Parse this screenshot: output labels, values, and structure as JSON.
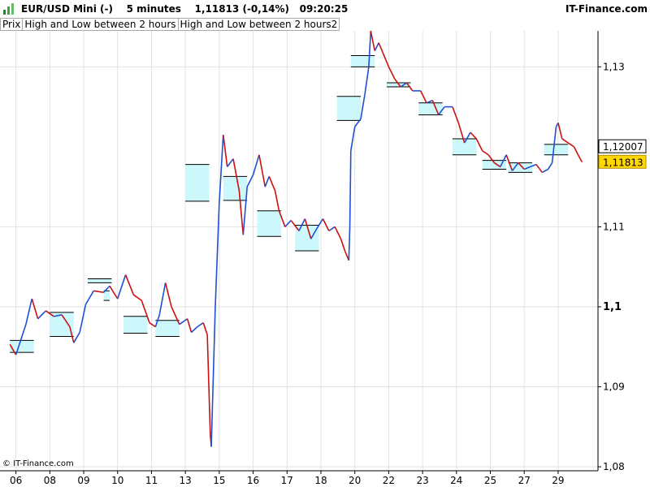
{
  "header": {
    "symbol": "EUR/USD Mini (-)",
    "interval": "5 minutes",
    "last_change": "1,11813 (-0,14%)",
    "time": "09:20:25",
    "brand": "IT-Finance.com"
  },
  "legend": [
    "Prix",
    "High and Low between 2 hours",
    "High and Low between 2 hours2"
  ],
  "copyright": "© IT-Finance.com",
  "colors": {
    "up": "#1f4fd6",
    "down": "#cc1010",
    "box_fill": "#ccf7fb",
    "box_border": "#000000",
    "grid": "#e2e2e2",
    "highlight": "#ffd700"
  },
  "chart_data": {
    "type": "line",
    "title": "EUR/USD Mini (-)",
    "xlabel": "",
    "ylabel": "",
    "ylim": [
      1.0795,
      1.1345
    ],
    "x_ticks": [
      "06",
      "08",
      "09",
      "10",
      "11",
      "13",
      "15",
      "16",
      "17",
      "18",
      "20",
      "22",
      "23",
      "24",
      "25",
      "27",
      "29"
    ],
    "y_ticks": [
      {
        "value": 1.13,
        "label": "1,13",
        "bold": false
      },
      {
        "value": 1.11,
        "label": "1,11",
        "bold": false
      },
      {
        "value": 1.1,
        "label": "1,1",
        "bold": true
      },
      {
        "value": 1.09,
        "label": "1,09",
        "bold": false
      },
      {
        "value": 1.08,
        "label": "1,08",
        "bold": false
      }
    ],
    "last_price": {
      "value": 1.11813,
      "label": "1,11813"
    },
    "ref_price": {
      "value": 1.12007,
      "label": "1,12007"
    },
    "price_path": [
      [
        0.0,
        1.0953
      ],
      [
        0.3,
        1.094
      ],
      [
        0.8,
        1.0978
      ],
      [
        1.1,
        1.101
      ],
      [
        1.4,
        1.0985
      ],
      [
        1.8,
        1.0995
      ],
      [
        2.2,
        1.0988
      ],
      [
        2.6,
        1.099
      ],
      [
        3.0,
        1.0975
      ],
      [
        3.2,
        1.0955
      ],
      [
        3.5,
        1.0968
      ],
      [
        3.8,
        1.1003
      ],
      [
        4.2,
        1.102
      ],
      [
        4.7,
        1.1018
      ],
      [
        5.0,
        1.1026
      ],
      [
        5.4,
        1.101
      ],
      [
        5.8,
        1.104
      ],
      [
        6.2,
        1.1015
      ],
      [
        6.6,
        1.1008
      ],
      [
        7.0,
        1.098
      ],
      [
        7.3,
        1.0975
      ],
      [
        7.5,
        1.099
      ],
      [
        7.8,
        1.103
      ],
      [
        8.1,
        1.1
      ],
      [
        8.5,
        1.0978
      ],
      [
        8.9,
        1.0985
      ],
      [
        9.1,
        1.0968
      ],
      [
        9.4,
        1.0975
      ],
      [
        9.7,
        1.098
      ],
      [
        9.9,
        1.0965
      ],
      [
        10.05,
        1.084
      ],
      [
        10.1,
        1.0825
      ],
      [
        10.3,
        1.1
      ],
      [
        10.5,
        1.113
      ],
      [
        10.7,
        1.1215
      ],
      [
        10.9,
        1.1175
      ],
      [
        11.2,
        1.1185
      ],
      [
        11.5,
        1.1145
      ],
      [
        11.7,
        1.109
      ],
      [
        11.9,
        1.115
      ],
      [
        12.2,
        1.1165
      ],
      [
        12.5,
        1.119
      ],
      [
        12.8,
        1.115
      ],
      [
        13.0,
        1.1163
      ],
      [
        13.3,
        1.1145
      ],
      [
        13.5,
        1.112
      ],
      [
        13.8,
        1.11
      ],
      [
        14.1,
        1.1108
      ],
      [
        14.5,
        1.1095
      ],
      [
        14.8,
        1.111
      ],
      [
        15.1,
        1.1085
      ],
      [
        15.4,
        1.1098
      ],
      [
        15.7,
        1.111
      ],
      [
        16.0,
        1.1095
      ],
      [
        16.3,
        1.11
      ],
      [
        16.6,
        1.1085
      ],
      [
        16.8,
        1.107
      ],
      [
        17.0,
        1.1058
      ],
      [
        17.05,
        1.11
      ],
      [
        17.1,
        1.1195
      ],
      [
        17.3,
        1.1225
      ],
      [
        17.6,
        1.1235
      ],
      [
        17.8,
        1.1265
      ],
      [
        18.0,
        1.13
      ],
      [
        18.1,
        1.1345
      ],
      [
        18.3,
        1.132
      ],
      [
        18.5,
        1.133
      ],
      [
        18.7,
        1.1318
      ],
      [
        19.0,
        1.13
      ],
      [
        19.3,
        1.1285
      ],
      [
        19.6,
        1.1275
      ],
      [
        19.9,
        1.128
      ],
      [
        20.2,
        1.127
      ],
      [
        20.6,
        1.127
      ],
      [
        20.9,
        1.1255
      ],
      [
        21.2,
        1.1258
      ],
      [
        21.5,
        1.124
      ],
      [
        21.8,
        1.125
      ],
      [
        22.2,
        1.125
      ],
      [
        22.5,
        1.123
      ],
      [
        22.8,
        1.1205
      ],
      [
        23.1,
        1.1218
      ],
      [
        23.4,
        1.121
      ],
      [
        23.7,
        1.1195
      ],
      [
        24.0,
        1.119
      ],
      [
        24.3,
        1.118
      ],
      [
        24.6,
        1.1175
      ],
      [
        24.9,
        1.119
      ],
      [
        25.2,
        1.117
      ],
      [
        25.5,
        1.118
      ],
      [
        25.8,
        1.1172
      ],
      [
        26.1,
        1.1175
      ],
      [
        26.4,
        1.1178
      ],
      [
        26.7,
        1.1168
      ],
      [
        27.0,
        1.1172
      ],
      [
        27.2,
        1.118
      ],
      [
        27.4,
        1.1225
      ],
      [
        27.5,
        1.123
      ],
      [
        27.7,
        1.121
      ],
      [
        28.0,
        1.1205
      ],
      [
        28.3,
        1.12
      ],
      [
        28.5,
        1.119
      ],
      [
        28.7,
        1.1181
      ]
    ],
    "range_boxes": [
      {
        "x0": 0.0,
        "x1": 1.2,
        "high": 1.0958,
        "low": 1.0943
      },
      {
        "x0": 2.0,
        "x1": 3.2,
        "high": 1.0993,
        "low": 1.0963
      },
      {
        "x0": 3.9,
        "x1": 5.1,
        "high": 1.1035,
        "low": 1.103
      },
      {
        "x0": 4.7,
        "x1": 5.0,
        "high": 1.102,
        "low": 1.1008
      },
      {
        "x0": 5.7,
        "x1": 6.9,
        "high": 1.0988,
        "low": 1.0967
      },
      {
        "x0": 7.3,
        "x1": 8.5,
        "high": 1.0983,
        "low": 1.0963
      },
      {
        "x0": 8.8,
        "x1": 10.0,
        "high": 1.1178,
        "low": 1.1132
      },
      {
        "x0": 10.7,
        "x1": 11.9,
        "high": 1.1163,
        "low": 1.1133
      },
      {
        "x0": 12.4,
        "x1": 13.6,
        "high": 1.112,
        "low": 1.1088
      },
      {
        "x0": 14.3,
        "x1": 15.5,
        "high": 1.1102,
        "low": 1.107
      },
      {
        "x0": 16.4,
        "x1": 17.6,
        "high": 1.1263,
        "low": 1.1233
      },
      {
        "x0": 17.1,
        "x1": 18.3,
        "high": 1.1314,
        "low": 1.13
      },
      {
        "x0": 18.9,
        "x1": 20.1,
        "high": 1.128,
        "low": 1.1275
      },
      {
        "x0": 20.5,
        "x1": 21.7,
        "high": 1.1255,
        "low": 1.124
      },
      {
        "x0": 22.2,
        "x1": 23.4,
        "high": 1.121,
        "low": 1.119
      },
      {
        "x0": 23.7,
        "x1": 24.9,
        "high": 1.1183,
        "low": 1.1172
      },
      {
        "x0": 25.0,
        "x1": 26.2,
        "high": 1.118,
        "low": 1.1168
      },
      {
        "x0": 26.8,
        "x1": 28.0,
        "high": 1.1203,
        "low": 1.119
      }
    ]
  }
}
